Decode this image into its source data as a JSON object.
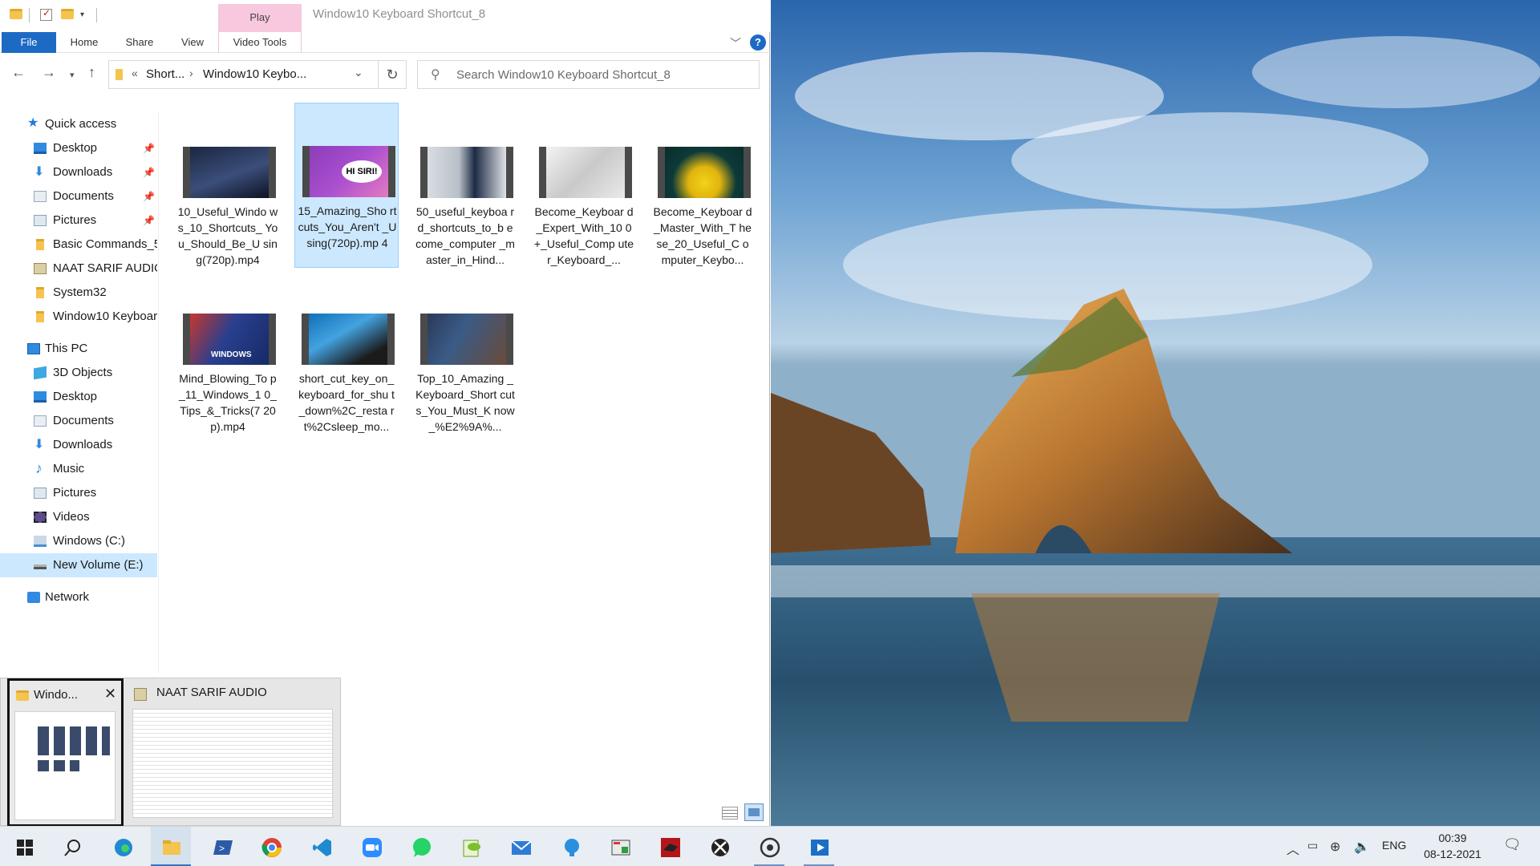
{
  "window": {
    "title": "Window10 Keyboard Shortcut_8",
    "context_tab": "Play",
    "ribbon_tabs": [
      "File",
      "Home",
      "Share",
      "View",
      "Video Tools"
    ],
    "help": "?"
  },
  "address": {
    "chevron": "«",
    "crumbs": [
      "Short...",
      "Window10 Keybo..."
    ],
    "separator": "›"
  },
  "search": {
    "placeholder": "Search Window10 Keyboard Shortcut_8"
  },
  "nav": {
    "quick_access": "Quick access",
    "quick_items": [
      "Desktop",
      "Downloads",
      "Documents",
      "Pictures",
      "Basic Commands_5",
      "NAAT SARIF AUDIO",
      "System32",
      "Window10 Keyboar"
    ],
    "this_pc": "This PC",
    "pc_items": [
      "3D Objects",
      "Desktop",
      "Documents",
      "Downloads",
      "Music",
      "Pictures",
      "Videos",
      "Windows (C:)",
      "New Volume (E:)"
    ],
    "network": "Network"
  },
  "files": [
    {
      "name": "10_Useful_Windows_10_Shortcuts_You_Should_Be_Using(720p).mp4",
      "display": "10_Useful_Windo ws_10_Shortcuts_ You_Should_Be_U sing(720p).mp4",
      "selected": false
    },
    {
      "name": "15_Amazing_Shortcuts_You_Aren't_Using(720p).mp4",
      "display": "15_Amazing_Sho rtcuts_You_Aren't _Using(720p).mp 4",
      "selected": true,
      "thumb_text": "HI SIRI!"
    },
    {
      "name": "50_useful_keyboard_shortcuts_to_become_computer_master_in_Hind...",
      "display": "50_useful_keyboa rd_shortcuts_to_b ecome_computer _master_in_Hind...",
      "selected": false
    },
    {
      "name": "Become_Keyboard_Expert_With_100+_Useful_Computer_Keyboard_...",
      "display": "Become_Keyboar d_Expert_With_10 0+_Useful_Comp uter_Keyboard_...",
      "selected": false
    },
    {
      "name": "Become_Keyboard_Master_With_These_20_Useful_Computer_Keybo...",
      "display": "Become_Keyboar d_Master_With_T hese_20_Useful_C omputer_Keybo...",
      "selected": false
    },
    {
      "name": "Mind_Blowing_Top_11_Windows_10_Tips_&_Tricks(720p).mp4",
      "display": "Mind_Blowing_To p_11_Windows_1 0_Tips_&_Tricks(7 20p).mp4",
      "selected": false,
      "thumb_text": "WINDOWS"
    },
    {
      "name": "short_cut_key_on_keyboard_for_shut_down%2C_restart%2Csleep_mo...",
      "display": "short_cut_key_on_ keyboard_for_shu t_down%2C_resta rt%2Csleep_mo...",
      "selected": false
    },
    {
      "name": "Top_10_Amazing_Keyboard_Shortcuts_You_Must_Know_%E2%9A%...",
      "display": "Top_10_Amazing _Keyboard_Short cuts_You_Must_K now_%E2%9A%...",
      "selected": false
    }
  ],
  "previews": [
    {
      "title": "Windo...",
      "icon": "folder-icon"
    },
    {
      "title": "NAAT SARIF AUDIO",
      "icon": "app-icon"
    }
  ],
  "taskbar": {
    "apps": [
      "start-icon",
      "search-icon",
      "edge-icon",
      "file-explorer-icon",
      "powershell-icon",
      "chrome-icon",
      "vscode-icon",
      "zoom-icon",
      "whatsapp-icon",
      "notepad-plus-icon",
      "mail-icon",
      "bulb-app-icon",
      "app-icon",
      "red-app-icon",
      "xbox-icon",
      "groove-icon",
      "media-player-icon"
    ],
    "lang": "ENG",
    "time": "00:39",
    "date": "08-12-2021"
  },
  "colors": {
    "accent": "#1c6ac3",
    "selection": "#cce8ff",
    "context_tab": "#f8c8de"
  }
}
